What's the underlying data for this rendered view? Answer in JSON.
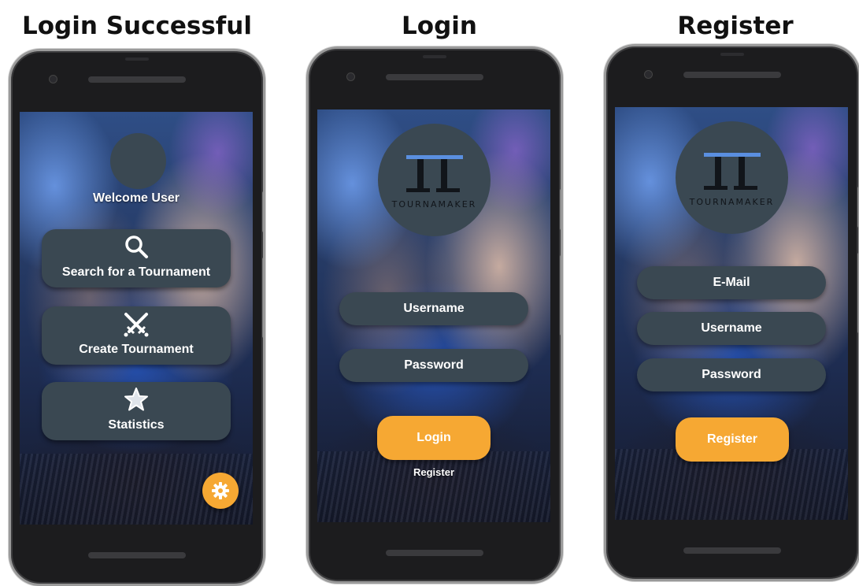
{
  "captions": {
    "success": "Login Successful",
    "login": "Login",
    "register": "Register"
  },
  "home_screen": {
    "welcome_text": "Welcome User",
    "menu": [
      {
        "label": "Search for a Tournament",
        "icon": "search-icon"
      },
      {
        "label": "Create Tournament",
        "icon": "crossed-swords-icon"
      },
      {
        "label": "Statistics",
        "icon": "star-icon"
      }
    ],
    "fab_icon": "gear-icon"
  },
  "login_screen": {
    "logo_text": "TOURNAMAKER",
    "username_label": "Username",
    "password_label": "Password",
    "login_button": "Login",
    "register_link": "Register"
  },
  "register_screen": {
    "logo_text": "TOURNAMAKER",
    "email_label": "E-Mail",
    "username_label": "Username",
    "password_label": "Password",
    "register_button": "Register"
  },
  "colors": {
    "slate": "#3a4852",
    "accent_orange": "#f6a833",
    "phone_body": "#1c1c1e"
  }
}
